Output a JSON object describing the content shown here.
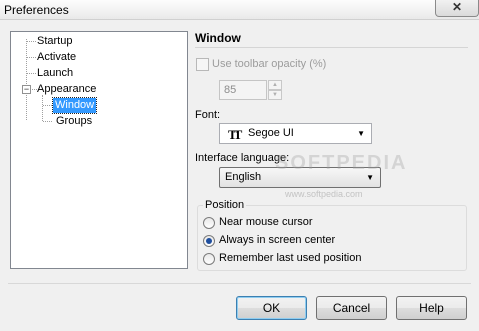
{
  "window": {
    "title": "Preferences",
    "close_glyph": "✕"
  },
  "tree": {
    "items": [
      {
        "label": "Startup"
      },
      {
        "label": "Activate"
      },
      {
        "label": "Launch"
      },
      {
        "label": "Appearance"
      },
      {
        "label": "Window",
        "selected": true
      },
      {
        "label": "Groups"
      }
    ],
    "expander_glyph": "−"
  },
  "panel": {
    "title": "Window",
    "toolbar_opacity": {
      "label": "Use toolbar opacity (%)",
      "checked": false,
      "enabled": false,
      "value": "85"
    },
    "font": {
      "label": "Font:",
      "value": "Segoe UI",
      "icon": "font-icon"
    },
    "language": {
      "label": "Interface language:",
      "value": "English"
    },
    "position": {
      "label": "Position",
      "options": [
        {
          "label": "Near mouse cursor",
          "checked": false
        },
        {
          "label": "Always in screen center",
          "checked": true
        },
        {
          "label": "Remember last used position",
          "checked": false
        }
      ]
    }
  },
  "watermark": {
    "text": "SOFTPEDIA",
    "sub": "www.softpedia.com"
  },
  "buttons": {
    "ok": "OK",
    "cancel": "Cancel",
    "help": "Help"
  },
  "colors": {
    "selection": "#3399ff",
    "default_button_border": "#3c7fb1"
  }
}
